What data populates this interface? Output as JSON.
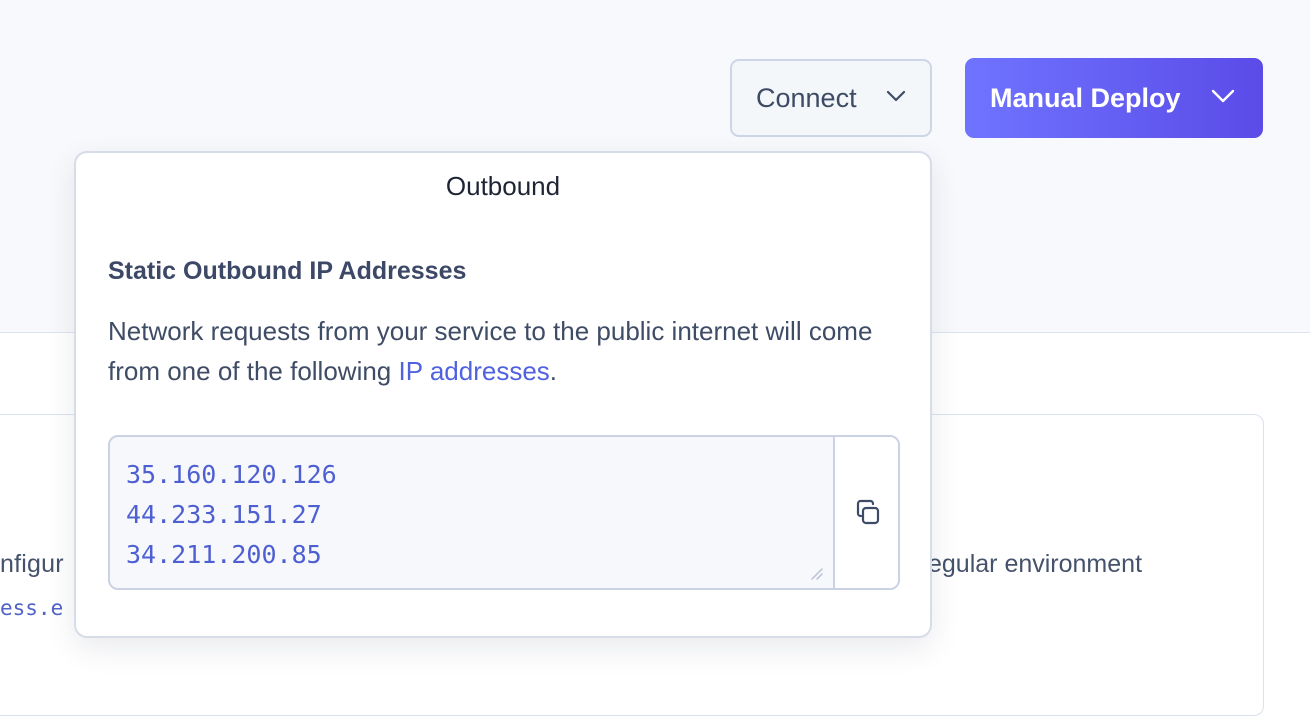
{
  "toolbar": {
    "connect_label": "Connect",
    "deploy_label": "Manual Deploy"
  },
  "popover": {
    "title": "Outbound",
    "heading": "Static Outbound IP Addresses",
    "description_prefix": "Network requests from your service to the public internet will come from one of the following ",
    "description_link": "IP addresses",
    "description_suffix": ".",
    "ip_addresses": [
      "35.160.120.126",
      "44.233.151.27",
      "34.211.200.85"
    ],
    "copy_icon": "copy-icon"
  },
  "background": {
    "left_text_fragment": "nfigur",
    "left_code_fragment": "ess.e",
    "right_text_fragment": "egular environment"
  },
  "colors": {
    "accent": "#5b4be8",
    "link": "#5062e0"
  }
}
